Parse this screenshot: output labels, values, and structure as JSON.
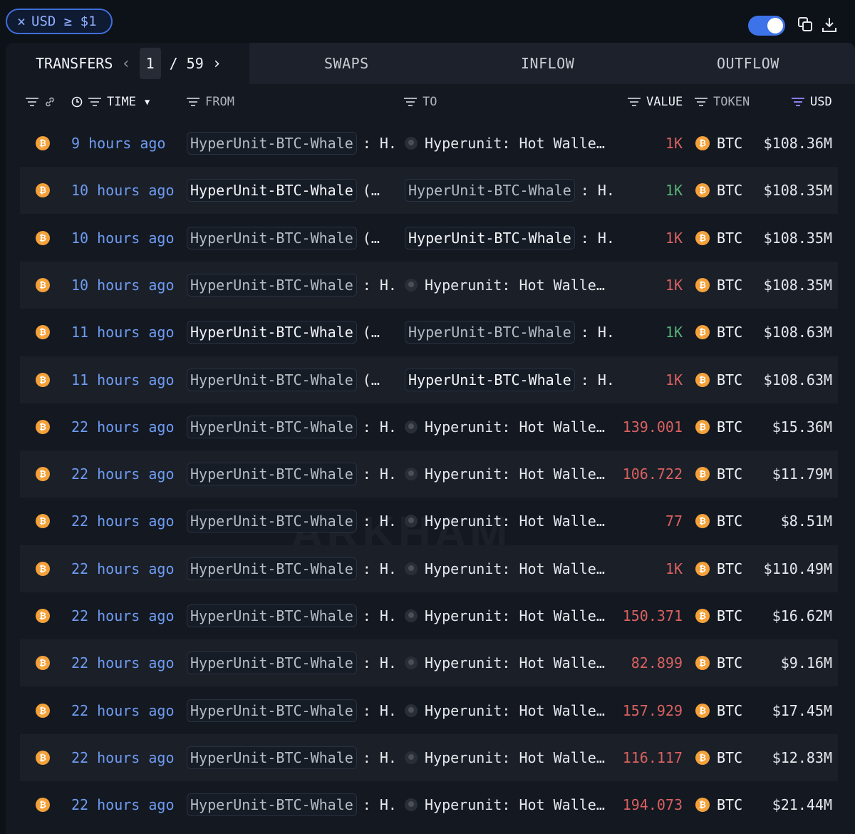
{
  "filter": {
    "label": "USD ≥ $1"
  },
  "tabs": {
    "transfers": "TRANSFERS",
    "page_current": "1",
    "page_sep": "/",
    "page_total": "59",
    "swaps": "SWAPS",
    "inflow": "INFLOW",
    "outflow": "OUTFLOW"
  },
  "columns": {
    "time": "TIME",
    "from": "FROM",
    "to": "TO",
    "value": "VALUE",
    "token": "TOKEN",
    "usd": "USD"
  },
  "watermark": "ARKHAM",
  "rows": [
    {
      "time": "9 hours ago",
      "from": "HyperUnit-BTC-Whale",
      "from_suffix": ": H.",
      "to_type": "hot",
      "to": "Hyperunit: Hot Walle…",
      "to_suffix": "",
      "value": "1K",
      "dir": "out",
      "token": "BTC",
      "usd": "$108.36M"
    },
    {
      "time": "10 hours ago",
      "from": "HyperUnit-BTC-Whale",
      "from_suffix": "(…",
      "to_type": "entity",
      "to": "HyperUnit-BTC-Whale",
      "to_suffix": ": H.",
      "value": "1K",
      "dir": "in",
      "token": "BTC",
      "usd": "$108.35M"
    },
    {
      "time": "10 hours ago",
      "from": "HyperUnit-BTC-Whale",
      "from_suffix": "(…",
      "to_type": "entity",
      "to": "HyperUnit-BTC-Whale",
      "to_suffix": ": H.",
      "value": "1K",
      "dir": "out",
      "token": "BTC",
      "usd": "$108.35M"
    },
    {
      "time": "10 hours ago",
      "from": "HyperUnit-BTC-Whale",
      "from_suffix": ": H.",
      "to_type": "hot",
      "to": "Hyperunit: Hot Walle…",
      "to_suffix": "",
      "value": "1K",
      "dir": "out",
      "token": "BTC",
      "usd": "$108.35M"
    },
    {
      "time": "11 hours ago",
      "from": "HyperUnit-BTC-Whale",
      "from_suffix": "(…",
      "to_type": "entity",
      "to": "HyperUnit-BTC-Whale",
      "to_suffix": ": H.",
      "value": "1K",
      "dir": "in",
      "token": "BTC",
      "usd": "$108.63M"
    },
    {
      "time": "11 hours ago",
      "from": "HyperUnit-BTC-Whale",
      "from_suffix": "(…",
      "to_type": "entity",
      "to": "HyperUnit-BTC-Whale",
      "to_suffix": ": H.",
      "value": "1K",
      "dir": "out",
      "token": "BTC",
      "usd": "$108.63M"
    },
    {
      "time": "22 hours ago",
      "from": "HyperUnit-BTC-Whale",
      "from_suffix": ": H.",
      "to_type": "hot",
      "to": "Hyperunit: Hot Walle…",
      "to_suffix": "",
      "value": "139.001",
      "dir": "out",
      "token": "BTC",
      "usd": "$15.36M"
    },
    {
      "time": "22 hours ago",
      "from": "HyperUnit-BTC-Whale",
      "from_suffix": ": H.",
      "to_type": "hot",
      "to": "Hyperunit: Hot Walle…",
      "to_suffix": "",
      "value": "106.722",
      "dir": "out",
      "token": "BTC",
      "usd": "$11.79M"
    },
    {
      "time": "22 hours ago",
      "from": "HyperUnit-BTC-Whale",
      "from_suffix": ": H.",
      "to_type": "hot",
      "to": "Hyperunit: Hot Walle…",
      "to_suffix": "",
      "value": "77",
      "dir": "out",
      "token": "BTC",
      "usd": "$8.51M"
    },
    {
      "time": "22 hours ago",
      "from": "HyperUnit-BTC-Whale",
      "from_suffix": ": H.",
      "to_type": "hot",
      "to": "Hyperunit: Hot Walle…",
      "to_suffix": "",
      "value": "1K",
      "dir": "out",
      "token": "BTC",
      "usd": "$110.49M"
    },
    {
      "time": "22 hours ago",
      "from": "HyperUnit-BTC-Whale",
      "from_suffix": ": H.",
      "to_type": "hot",
      "to": "Hyperunit: Hot Walle…",
      "to_suffix": "",
      "value": "150.371",
      "dir": "out",
      "token": "BTC",
      "usd": "$16.62M"
    },
    {
      "time": "22 hours ago",
      "from": "HyperUnit-BTC-Whale",
      "from_suffix": ": H.",
      "to_type": "hot",
      "to": "Hyperunit: Hot Walle…",
      "to_suffix": "",
      "value": "82.899",
      "dir": "out",
      "token": "BTC",
      "usd": "$9.16M"
    },
    {
      "time": "22 hours ago",
      "from": "HyperUnit-BTC-Whale",
      "from_suffix": ": H.",
      "to_type": "hot",
      "to": "Hyperunit: Hot Walle…",
      "to_suffix": "",
      "value": "157.929",
      "dir": "out",
      "token": "BTC",
      "usd": "$17.45M"
    },
    {
      "time": "22 hours ago",
      "from": "HyperUnit-BTC-Whale",
      "from_suffix": ": H.",
      "to_type": "hot",
      "to": "Hyperunit: Hot Walle…",
      "to_suffix": "",
      "value": "116.117",
      "dir": "out",
      "token": "BTC",
      "usd": "$12.83M"
    },
    {
      "time": "22 hours ago",
      "from": "HyperUnit-BTC-Whale",
      "from_suffix": ": H.",
      "to_type": "hot",
      "to": "Hyperunit: Hot Walle…",
      "to_suffix": "",
      "value": "194.073",
      "dir": "out",
      "token": "BTC",
      "usd": "$21.44M"
    }
  ],
  "colors": {
    "accent": "#3d73e8",
    "time_link": "#6f9cf2",
    "outflow_value": "#d9615f",
    "inflow_value": "#56b377",
    "btc": "#f4a13a"
  },
  "icons": {
    "token": "bitcoin-icon",
    "to_hot": "hot-wallet-icon"
  }
}
